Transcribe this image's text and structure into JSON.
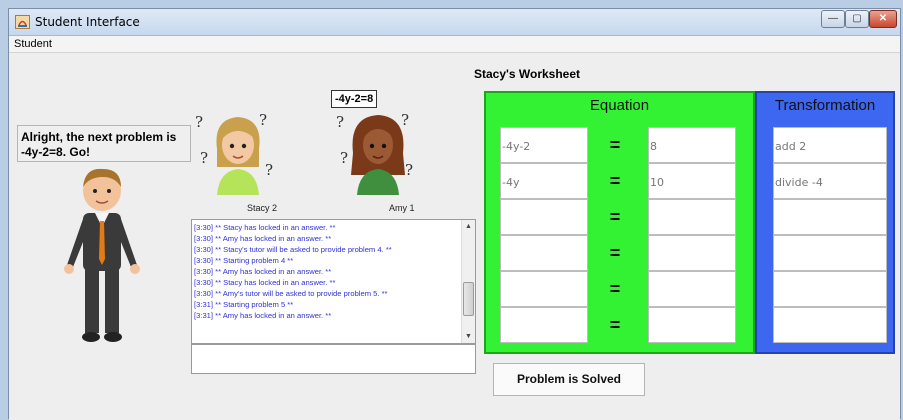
{
  "window": {
    "title": "Student Interface",
    "minimize_glyph": "—",
    "maximize_glyph": "▢",
    "close_glyph": "✕"
  },
  "menu": {
    "items": [
      "Student"
    ]
  },
  "tutor": {
    "speech": "Alright, the next problem is -4y-2=8. Go!"
  },
  "worksheet": {
    "title": "Stacy's Worksheet",
    "problem": "-4y-2=8"
  },
  "avatars": [
    {
      "label": "Stacy 2",
      "hair": "#c9a14d",
      "shirt": "#b5e45b"
    },
    {
      "label": "Amy 1",
      "hair": "#7a3a1a",
      "shirt": "#3f8f3f"
    }
  ],
  "chat": {
    "lines": [
      "[3:30] ** Stacy has locked in an answer. **",
      "[3:30] ** Amy has locked in an answer. **",
      "[3:30] ** Stacy's tutor will be asked to provide problem 4. **",
      "[3:30] ** Starting problem 4 **",
      "[3:30] ** Amy has locked in an answer. **",
      "[3:30] ** Stacy has locked in an answer. **",
      "[3:30] ** Amy's tutor will be asked to provide problem 5. **",
      "[3:31] ** Starting problem 5 **",
      "[3:31] ** Amy has locked in an answer. **"
    ],
    "input_value": ""
  },
  "equation_panel": {
    "heading": "Equation",
    "equals_sign": "=",
    "rows": [
      {
        "left": "-4y-2",
        "right": "8"
      },
      {
        "left": "-4y",
        "right": "10"
      },
      {
        "left": "",
        "right": ""
      },
      {
        "left": "",
        "right": ""
      },
      {
        "left": "",
        "right": ""
      },
      {
        "left": "",
        "right": ""
      }
    ]
  },
  "transformation_panel": {
    "heading": "Transformation",
    "rows": [
      "add 2",
      "divide -4",
      "",
      "",
      "",
      ""
    ]
  },
  "solve_button": {
    "label": "Problem is Solved"
  },
  "colors": {
    "equation_bg": "#33f233",
    "transformation_bg": "#3d67f0",
    "chat_text": "#3131d9"
  }
}
